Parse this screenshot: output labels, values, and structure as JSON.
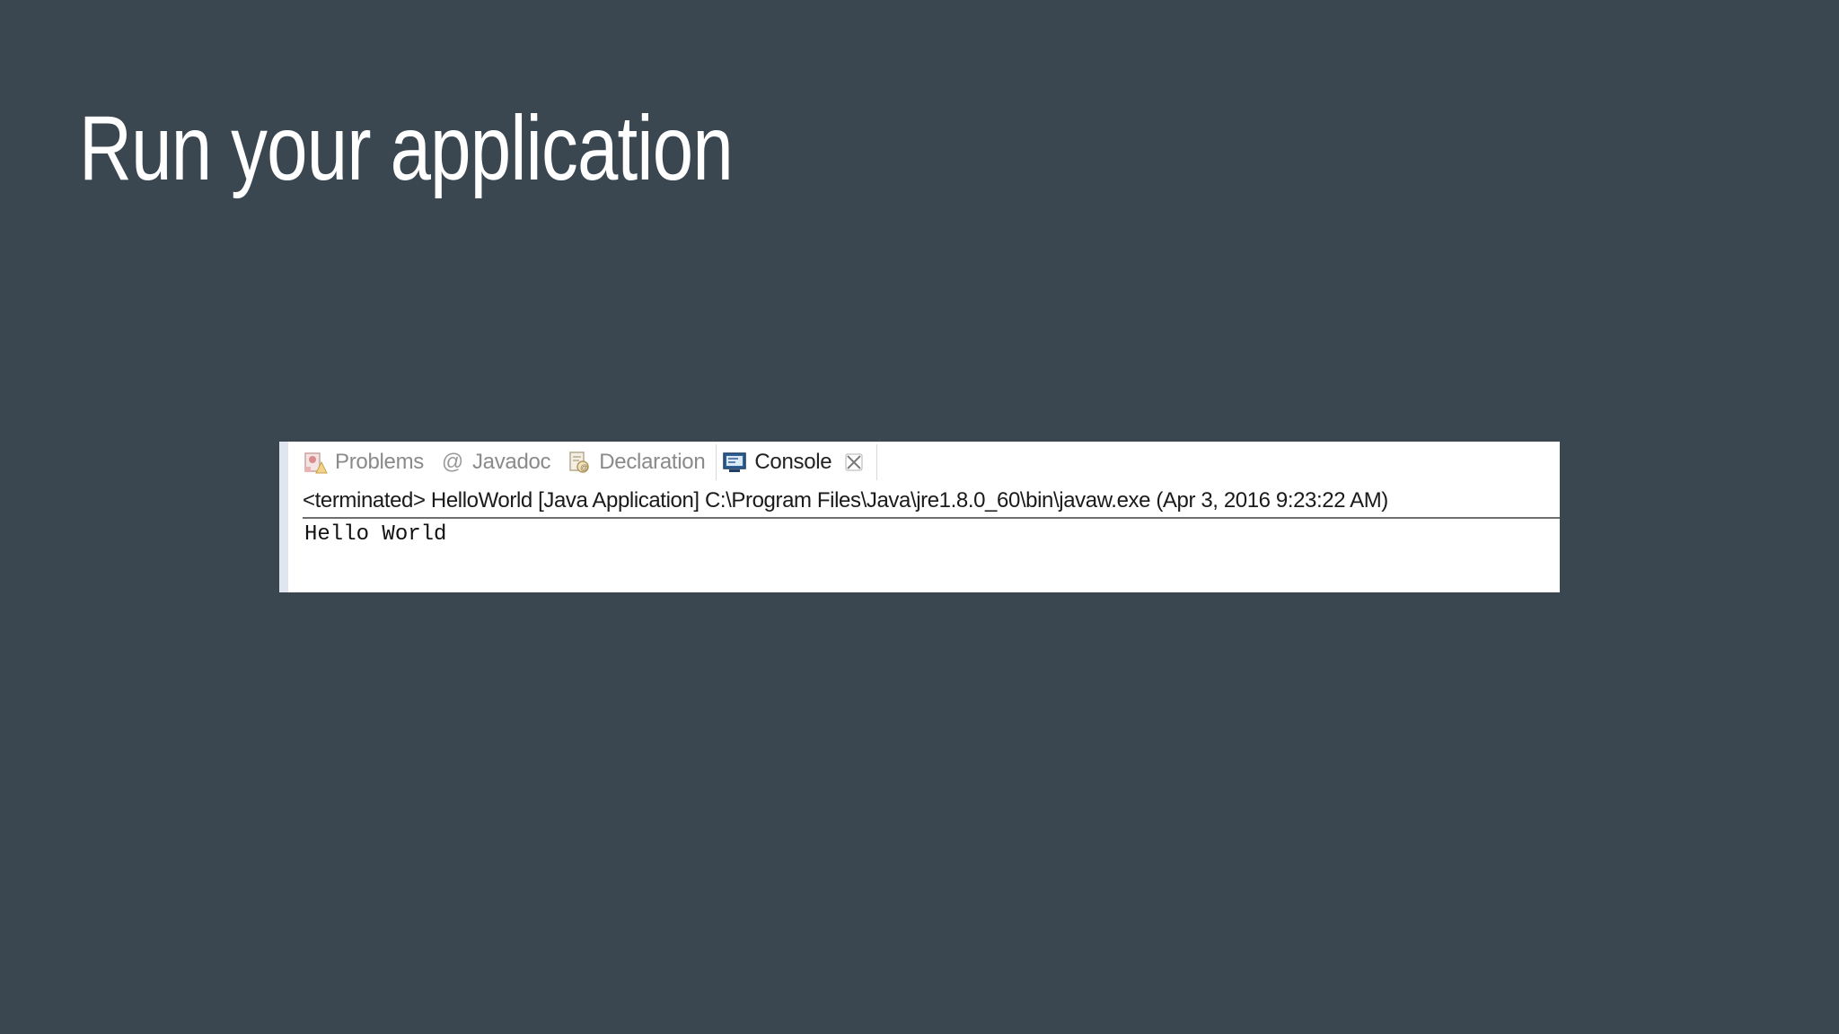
{
  "slide": {
    "title": "Run your application",
    "background_color": "#3a4650"
  },
  "eclipse_view": {
    "tabs": [
      {
        "label": "Problems",
        "icon": "problems-icon",
        "active": false
      },
      {
        "label": "Javadoc",
        "icon": "javadoc-at-icon",
        "active": false
      },
      {
        "label": "Declaration",
        "icon": "declaration-icon",
        "active": false
      },
      {
        "label": "Console",
        "icon": "console-icon",
        "active": true
      }
    ],
    "javadoc_glyph": "@",
    "status_line": "<terminated> HelloWorld [Java Application] C:\\Program Files\\Java\\jre1.8.0_60\\bin\\javaw.exe (Apr 3, 2016 9:23:22 AM)",
    "output": "Hello World"
  }
}
